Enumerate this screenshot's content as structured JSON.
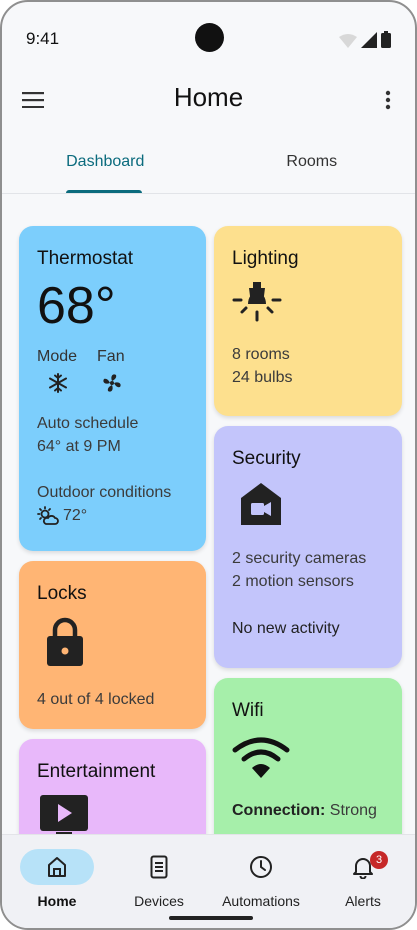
{
  "status_bar": {
    "time": "9:41"
  },
  "app_bar": {
    "title": "Home"
  },
  "tabs": [
    {
      "label": "Dashboard",
      "active": true
    },
    {
      "label": "Rooms",
      "active": false
    }
  ],
  "cards": {
    "thermostat": {
      "title": "Thermostat",
      "temperature": "68°",
      "mode_label": "Mode",
      "fan_label": "Fan",
      "schedule_title": "Auto schedule",
      "schedule_value": "64° at 9 PM",
      "outdoor_title": "Outdoor conditions",
      "outdoor_value": "72°",
      "color": "#7ccefc"
    },
    "lighting": {
      "title": "Lighting",
      "rooms": "8 rooms",
      "bulbs": "24 bulbs",
      "color": "#fde08e"
    },
    "security": {
      "title": "Security",
      "cameras": "2 security cameras",
      "sensors": "2 motion sensors",
      "activity": "No new activity",
      "color": "#c3c5fb"
    },
    "locks": {
      "title": "Locks",
      "status": "4 out of 4 locked",
      "color": "#ffb574"
    },
    "wifi": {
      "title": "Wifi",
      "connection_label": "Connection:",
      "connection_value": "Strong",
      "color": "#a6efaa"
    },
    "entertainment": {
      "title": "Entertainment",
      "color": "#e8b8fa"
    }
  },
  "bottom_nav": [
    {
      "label": "Home",
      "icon": "home-icon",
      "active": true
    },
    {
      "label": "Devices",
      "icon": "devices-icon",
      "active": false
    },
    {
      "label": "Automations",
      "icon": "clock-icon",
      "active": false
    },
    {
      "label": "Alerts",
      "icon": "bell-icon",
      "active": false,
      "badge": "3"
    }
  ],
  "colors": {
    "accent": "#0b6b7d",
    "nav_active": "#b7e2f8",
    "badge": "#c62828"
  }
}
